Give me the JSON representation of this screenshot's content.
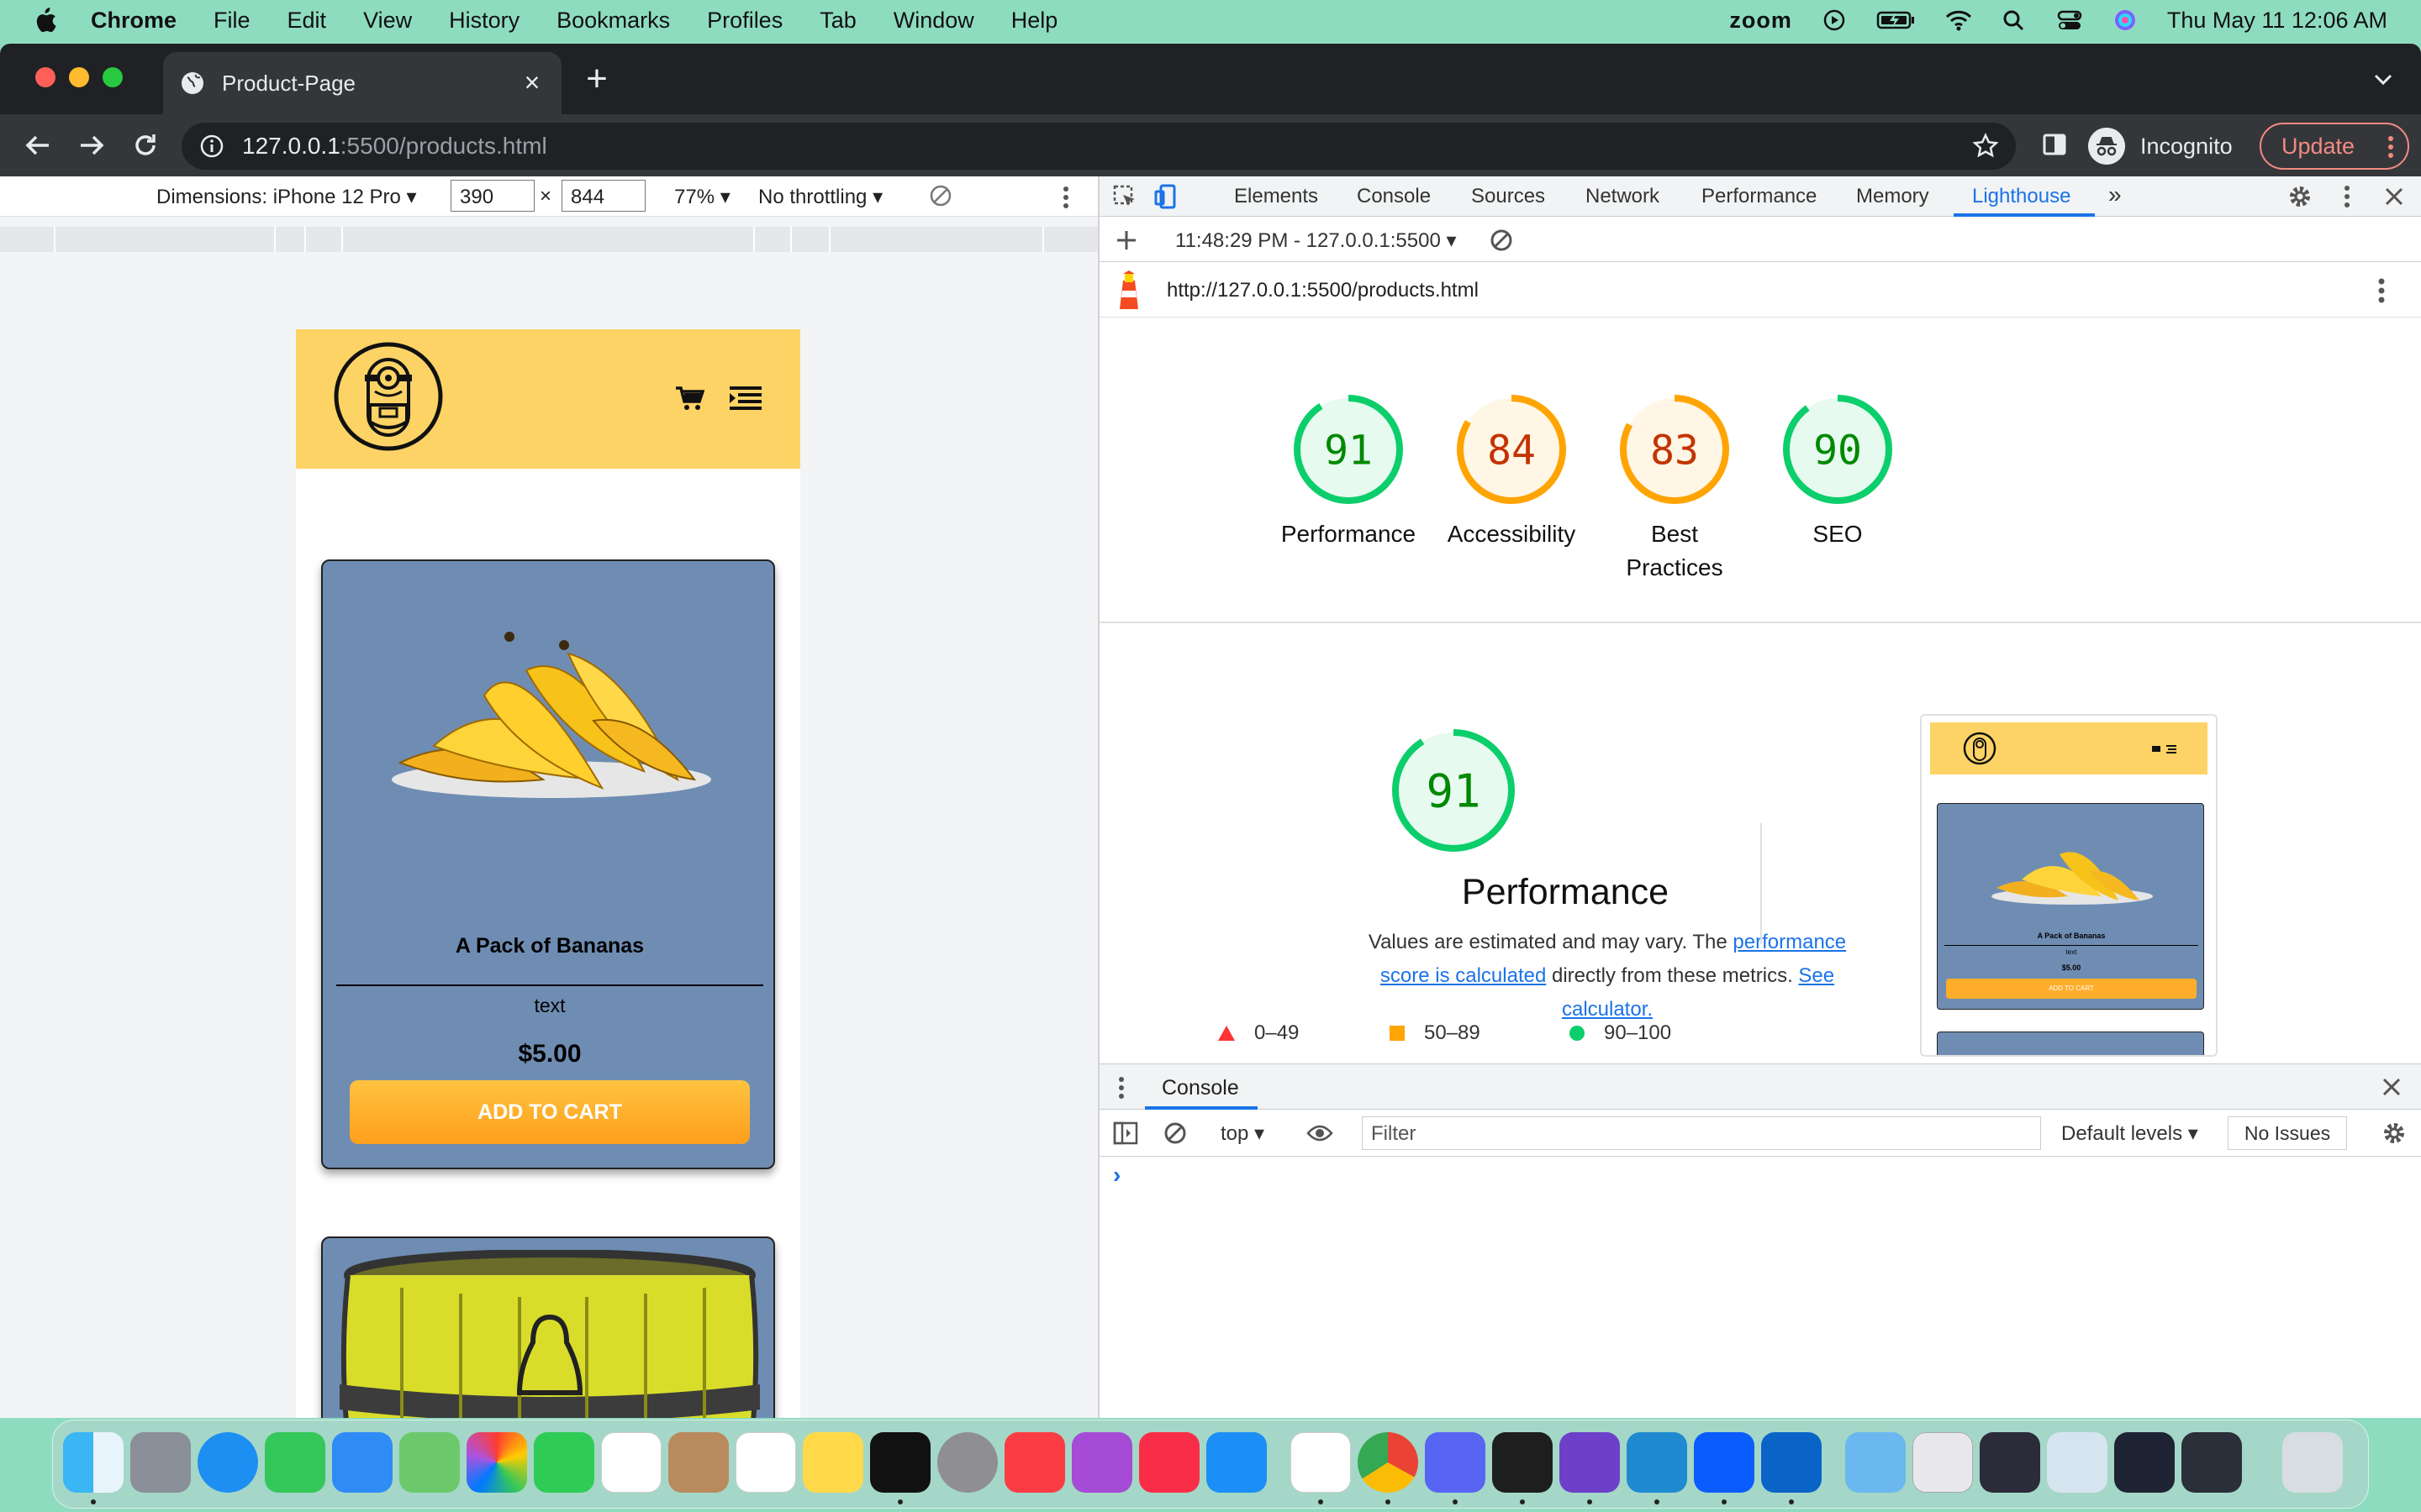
{
  "menubar": {
    "app": "Chrome",
    "items": [
      "File",
      "Edit",
      "View",
      "History",
      "Bookmarks",
      "Profiles",
      "Tab",
      "Window",
      "Help"
    ],
    "zoom_label": "zoom",
    "clock": "Thu May 11  12:06 AM"
  },
  "browser": {
    "tab_title": "Product-Page",
    "url_host": "127.0.0.1",
    "url_path": ":5500/products.html",
    "profile_label": "Incognito",
    "update_label": "Update"
  },
  "device_toolbar": {
    "dimensions_label": "Dimensions: iPhone 12 Pro",
    "width": "390",
    "height": "844",
    "times": "×",
    "zoom": "77%",
    "throttle": "No throttling"
  },
  "page": {
    "products": [
      {
        "title": "A Pack of Bananas",
        "description": "text",
        "price": "$5.00",
        "button": "ADD TO CART"
      }
    ]
  },
  "devtools": {
    "tabs": [
      "Elements",
      "Console",
      "Sources",
      "Network",
      "Performance",
      "Memory",
      "Lighthouse"
    ],
    "active_tab": "Lighthouse",
    "more": "»",
    "report_select": "11:48:29 PM - 127.0.0.1:5500",
    "report_url": "http://127.0.0.1:5500/products.html",
    "scores": [
      {
        "label": "Performance",
        "value": 91,
        "color": "#0cce6b"
      },
      {
        "label": "Accessibility",
        "value": 84,
        "color": "#ffa400"
      },
      {
        "label": "Best Practices",
        "value": 83,
        "color": "#ffa400"
      },
      {
        "label": "SEO",
        "value": 90,
        "color": "#0cce6b"
      }
    ],
    "performance": {
      "score": 91,
      "title": "Performance",
      "desc_before": "Values are estimated and may vary. The ",
      "desc_link1": "performance score is calculated",
      "desc_middle": " directly from these metrics. ",
      "desc_link2": "See calculator."
    },
    "legend": [
      {
        "range": "0–49",
        "color": "#ff3333"
      },
      {
        "range": "50–89",
        "color": "#ffa400"
      },
      {
        "range": "90–100",
        "color": "#0cce6b"
      }
    ],
    "thumbnail": {
      "title": "A Pack of Bananas",
      "desc": "text",
      "price": "$5.00",
      "button": "ADD TO CART"
    },
    "console": {
      "title": "Console",
      "context": "top",
      "filter_placeholder": "Filter",
      "levels": "Default levels",
      "issues": "No Issues",
      "prompt": "›"
    }
  },
  "colors": {
    "menubar_bg": "#8edcc0",
    "page_header": "#fdd366",
    "product_card": "#6f8db3",
    "button_orange": "#ff9f1c",
    "devtools_blue": "#1a73e8"
  }
}
